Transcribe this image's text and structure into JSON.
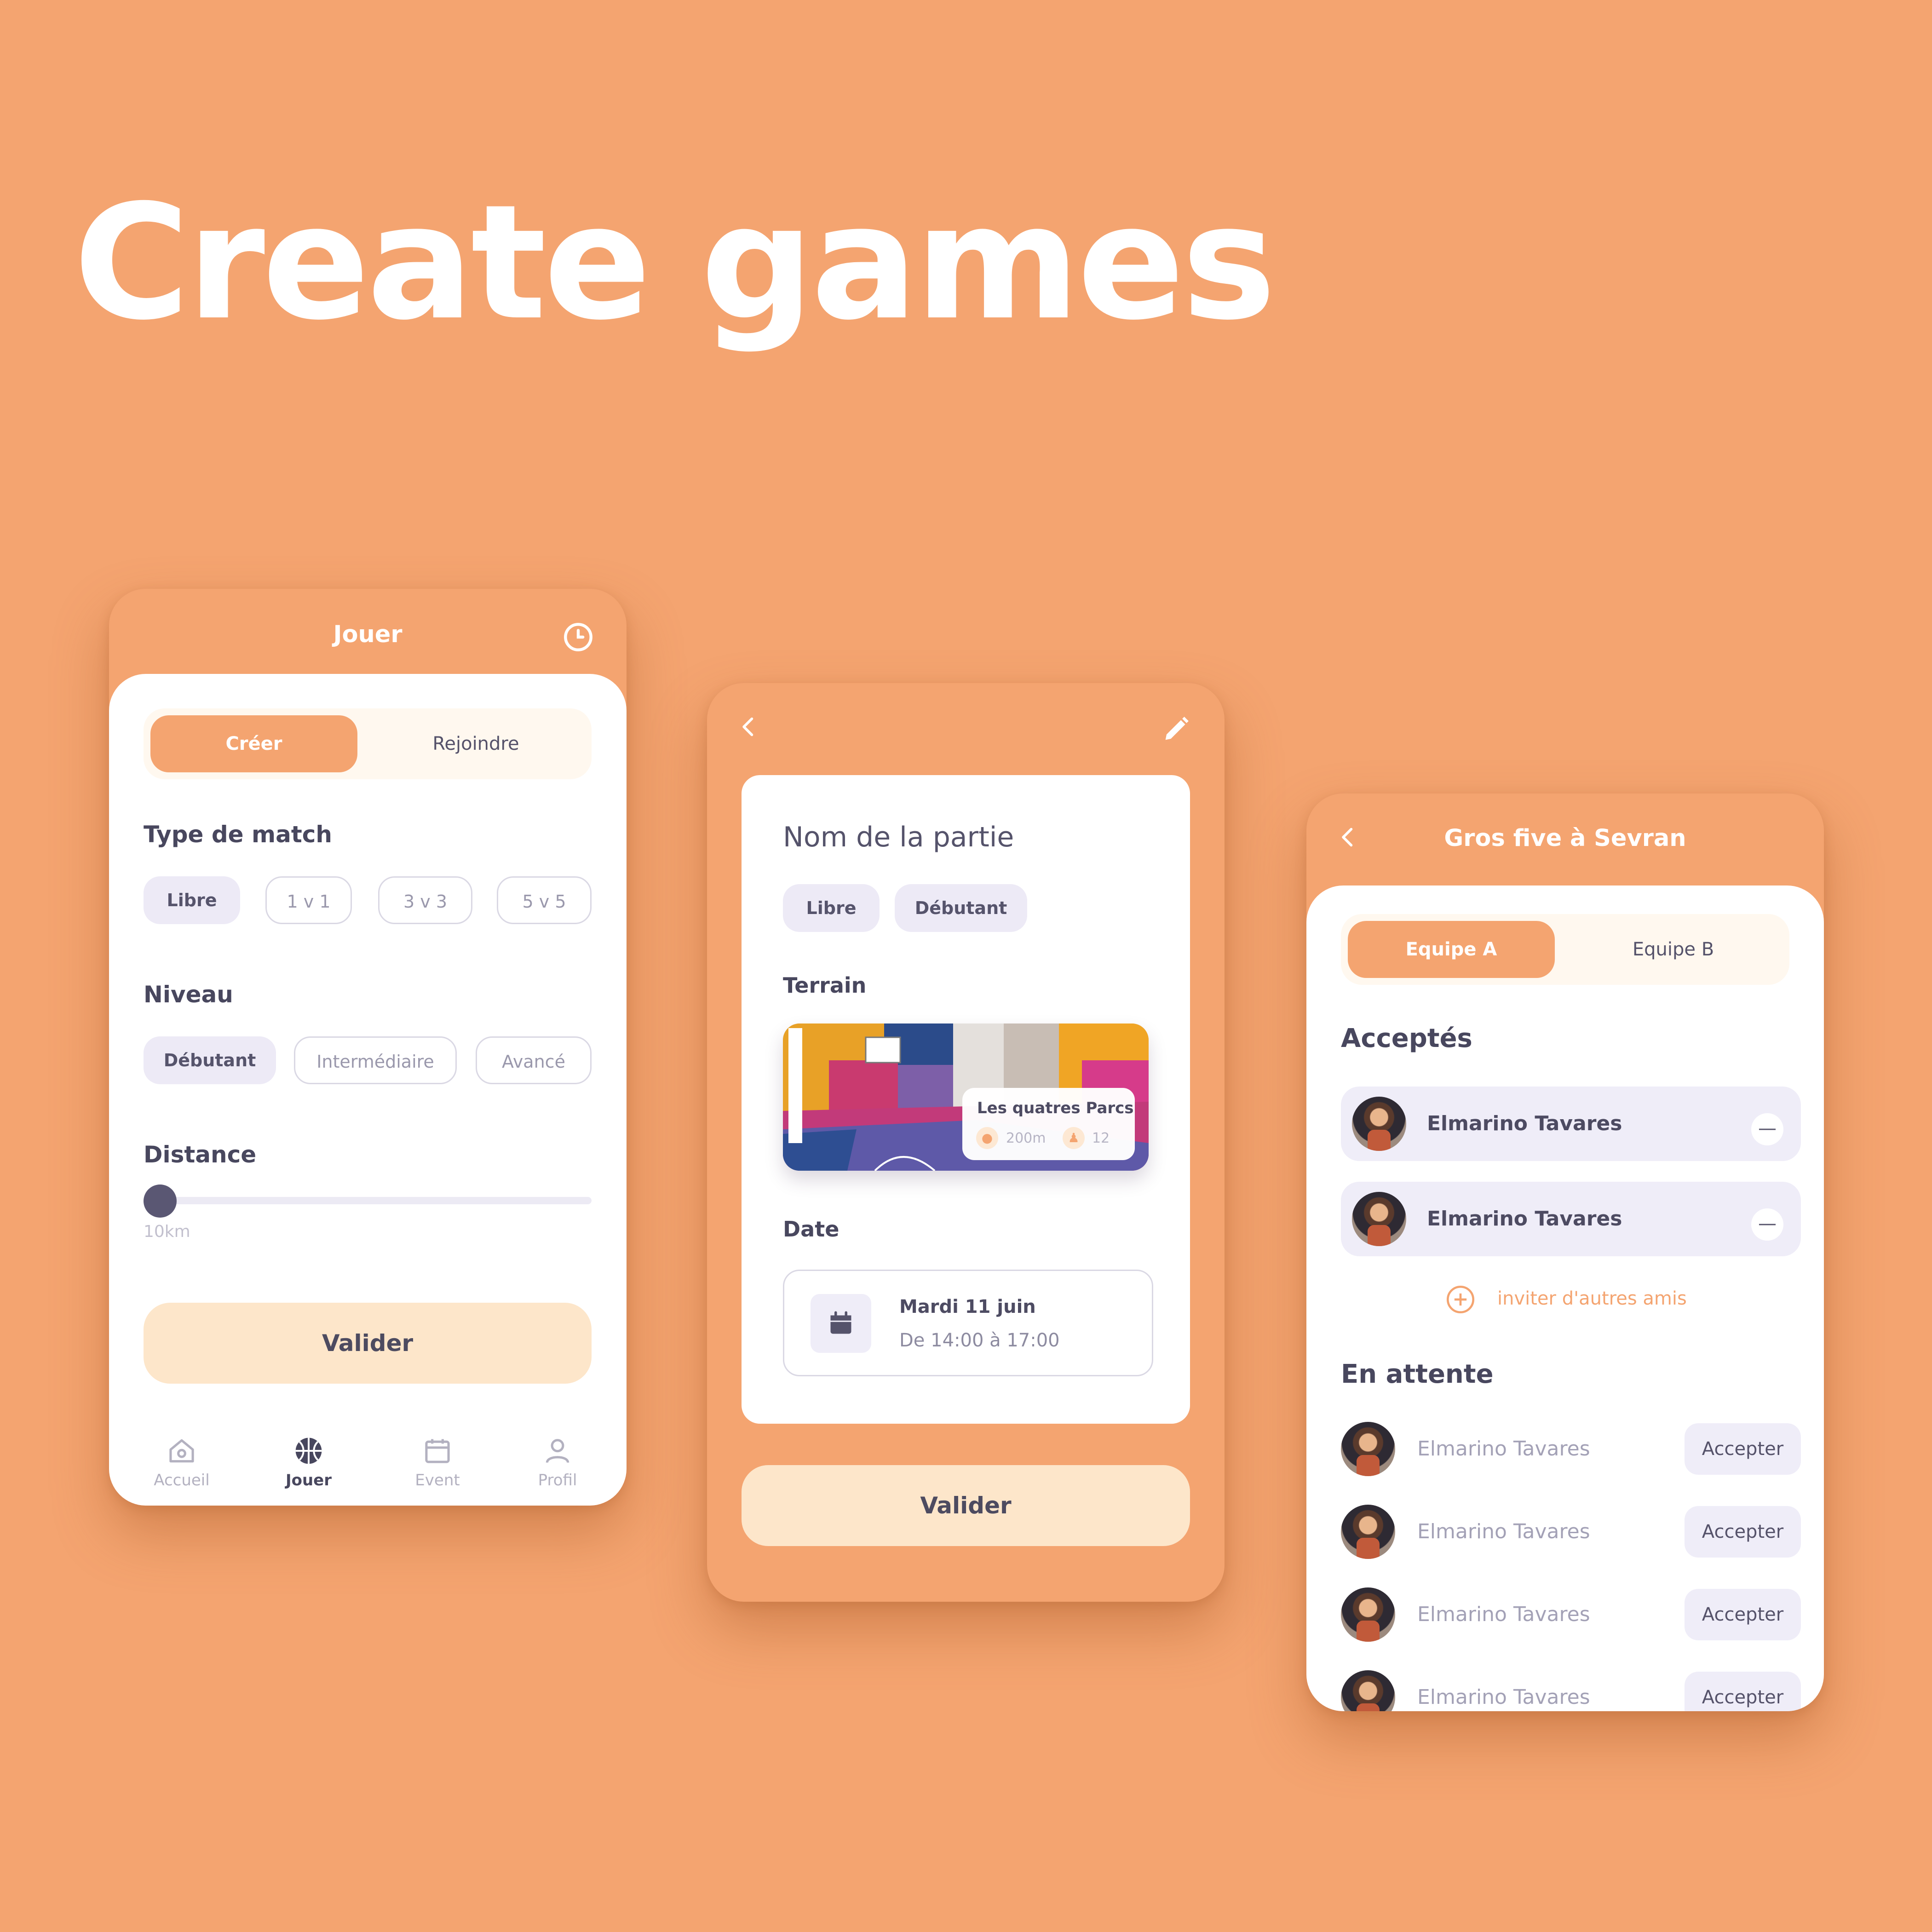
{
  "headline": "Create games",
  "colors": {
    "background": "#F4A470",
    "accent": "#F4A470",
    "valider_bg": "#FDE6CA",
    "chip_selected": "#EDEAF6",
    "text_dark": "#48475E"
  },
  "screen1": {
    "title": "Jouer",
    "tabs": {
      "active": "Créer",
      "inactive": "Rejoindre"
    },
    "match_type_label": "Type de match",
    "match_types": [
      "Libre",
      "1 v 1",
      "3 v 3",
      "5 v 5"
    ],
    "level_label": "Niveau",
    "levels": [
      "Débutant",
      "Intermédiaire",
      "Avancé"
    ],
    "distance_label": "Distance",
    "distance_value": "10km",
    "distance_fraction": 0.0,
    "submit": "Valider",
    "nav": [
      "Accueil",
      "Jouer",
      "Event",
      "Profil"
    ]
  },
  "screen2": {
    "game_name_placeholder": "Nom de la partie",
    "tags": [
      "Libre",
      "Débutant"
    ],
    "terrain_label": "Terrain",
    "terrain_name": "Les quatres Parcs",
    "terrain_distance": "200m",
    "terrain_players": "12",
    "date_label": "Date",
    "date_day": "Mardi 11 juin",
    "date_time": "De 14:00 à 17:00",
    "submit": "Valider"
  },
  "screen3": {
    "title": "Gros five à Sevran",
    "tabs": {
      "active": "Equipe A",
      "inactive": "Equipe B"
    },
    "accepted_label": "Acceptés",
    "accepted": [
      "Elmarino Tavares",
      "Elmarino Tavares"
    ],
    "invite": "inviter d'autres amis",
    "pending_label": "En attente",
    "pending": [
      "Elmarino Tavares",
      "Elmarino Tavares",
      "Elmarino Tavares",
      "Elmarino Tavares"
    ],
    "accept_label": "Accepter"
  }
}
